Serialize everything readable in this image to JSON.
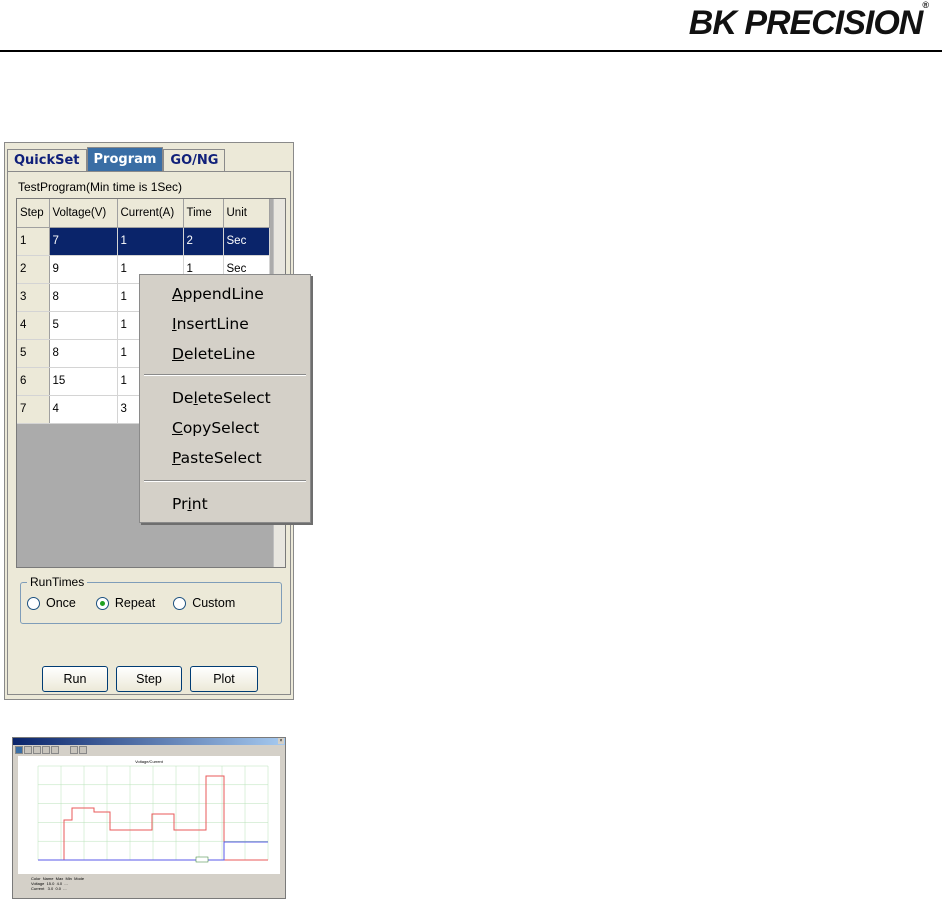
{
  "brand": {
    "name": "BK PRECISION",
    "mark": "®"
  },
  "panel": {
    "tabs": [
      {
        "label": "QuickSet",
        "active": false
      },
      {
        "label": "Program",
        "active": true
      },
      {
        "label": "GO/NG",
        "active": false
      }
    ],
    "program_title": "TestProgram(Min time is 1Sec)",
    "table": {
      "headers": [
        "Step",
        "Voltage(V)",
        "Current(A)",
        "Time",
        "Unit"
      ],
      "rows": [
        {
          "step": "1",
          "voltage": "7",
          "current": "1",
          "time": "2",
          "unit": "Sec",
          "selected": true
        },
        {
          "step": "2",
          "voltage": "9",
          "current": "1",
          "time": "1",
          "unit": "Sec"
        },
        {
          "step": "3",
          "voltage": "8",
          "current": "1",
          "time": "",
          "unit": ""
        },
        {
          "step": "4",
          "voltage": "5",
          "current": "1",
          "time": "",
          "unit": ""
        },
        {
          "step": "5",
          "voltage": "8",
          "current": "1",
          "time": "",
          "unit": ""
        },
        {
          "step": "6",
          "voltage": "15",
          "current": "1",
          "time": "",
          "unit": ""
        },
        {
          "step": "7",
          "voltage": "4",
          "current": "3",
          "time": "",
          "unit": ""
        }
      ]
    },
    "runtimes": {
      "legend": "RunTimes",
      "options": [
        {
          "label": "Once",
          "checked": false
        },
        {
          "label": "Repeat",
          "checked": true
        },
        {
          "label": "Custom",
          "checked": false
        }
      ]
    },
    "buttons": {
      "run": "Run",
      "step": "Step",
      "plot": "Plot"
    }
  },
  "context_menu": {
    "group1": [
      {
        "pre": "",
        "acc": "A",
        "post": "ppendLine"
      },
      {
        "pre": "",
        "acc": "I",
        "post": "nsertLine"
      },
      {
        "pre": "",
        "acc": "D",
        "post": "eleteLine"
      }
    ],
    "group2": [
      {
        "pre": "De",
        "acc": "l",
        "post": "eteSelect"
      },
      {
        "pre": "",
        "acc": "C",
        "post": "opySelect"
      },
      {
        "pre": "",
        "acc": "P",
        "post": "asteSelect"
      }
    ],
    "group3": [
      {
        "pre": "Pr",
        "acc": "i",
        "post": "nt"
      }
    ]
  },
  "plot_window": {
    "title": "Voltage/Current",
    "legend": "Color  Name  Max  Min  Mode\nVoltage  15.0  4.0  ...\nCurrent   3.0  0.0  ...",
    "colors": {
      "voltage": "#e85a5a",
      "current": "#5a5ae8",
      "grid": "#b8e2b8"
    }
  }
}
